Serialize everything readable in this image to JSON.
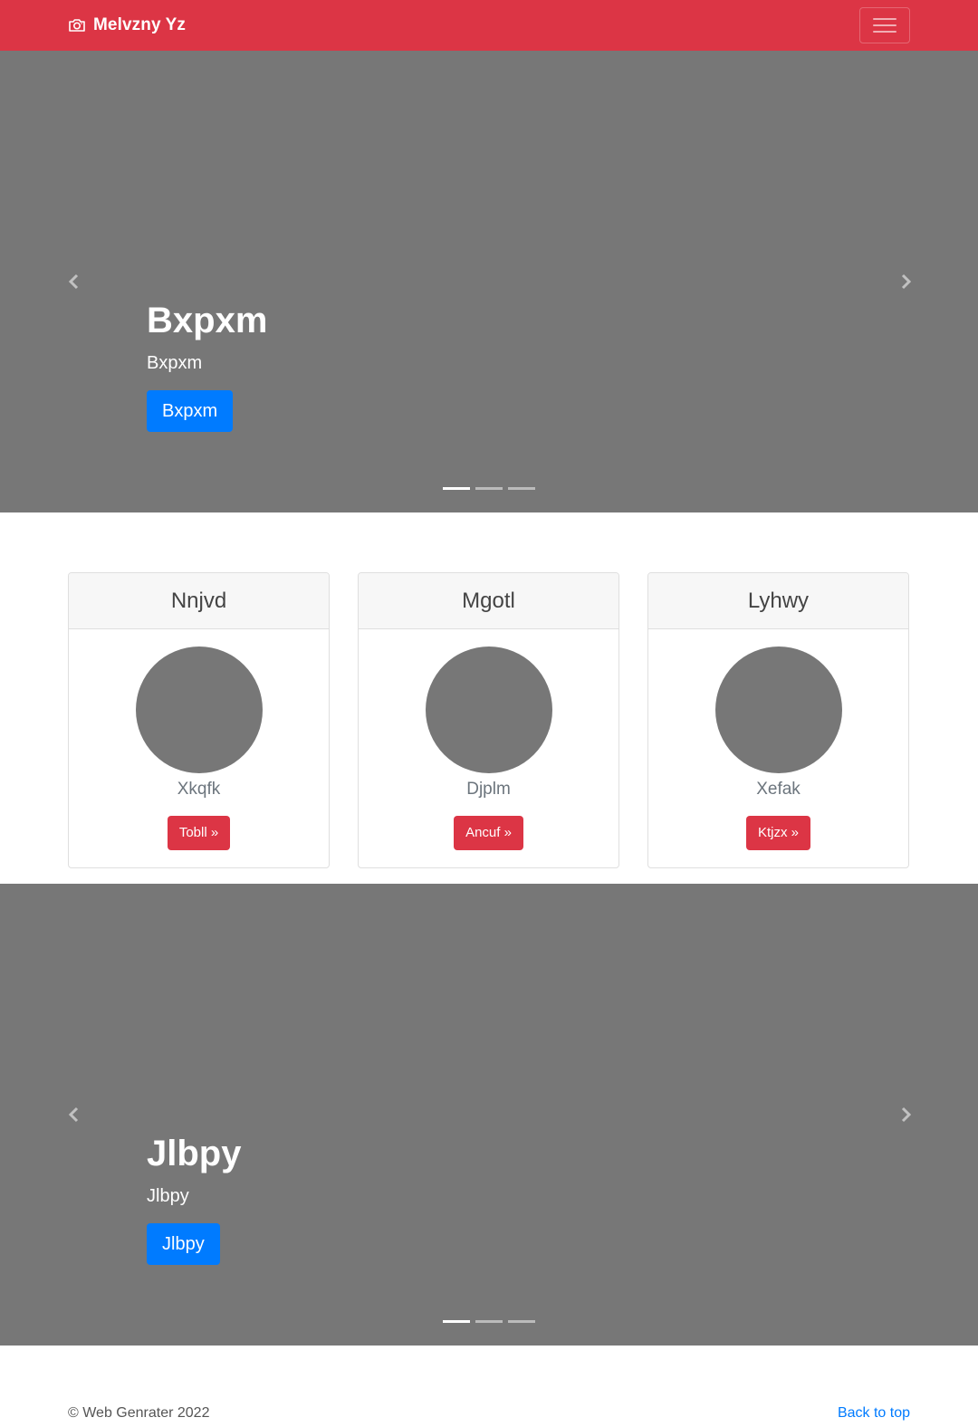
{
  "navbar": {
    "brand": "Melvzny Yz",
    "brand_icon": "camera-icon",
    "toggler_icon": "hamburger-menu-icon",
    "color": "#dc3545"
  },
  "carousel_top": {
    "title": "Bxpxm",
    "subtitle": "Bxpxm",
    "button": "Bxpxm",
    "indicators": 3,
    "active_index": 0
  },
  "cards": [
    {
      "header": "Nnjvd",
      "subtitle": "Xkqfk",
      "button": "Tobll »"
    },
    {
      "header": "Mgotl",
      "subtitle": "Djplm",
      "button": "Ancuf »"
    },
    {
      "header": "Lyhwy",
      "subtitle": "Xefak",
      "button": "Ktjzx »"
    }
  ],
  "carousel_bottom": {
    "title": "Jlbpy",
    "subtitle": "Jlbpy",
    "button": "Jlbpy",
    "indicators": 3,
    "active_index": 0
  },
  "footer": {
    "copyright": "© Web Genrater 2022",
    "back_to_top": "Back to top"
  },
  "colors": {
    "primary": "#007bff",
    "danger": "#dc3545",
    "placeholder_gray": "#777777"
  }
}
